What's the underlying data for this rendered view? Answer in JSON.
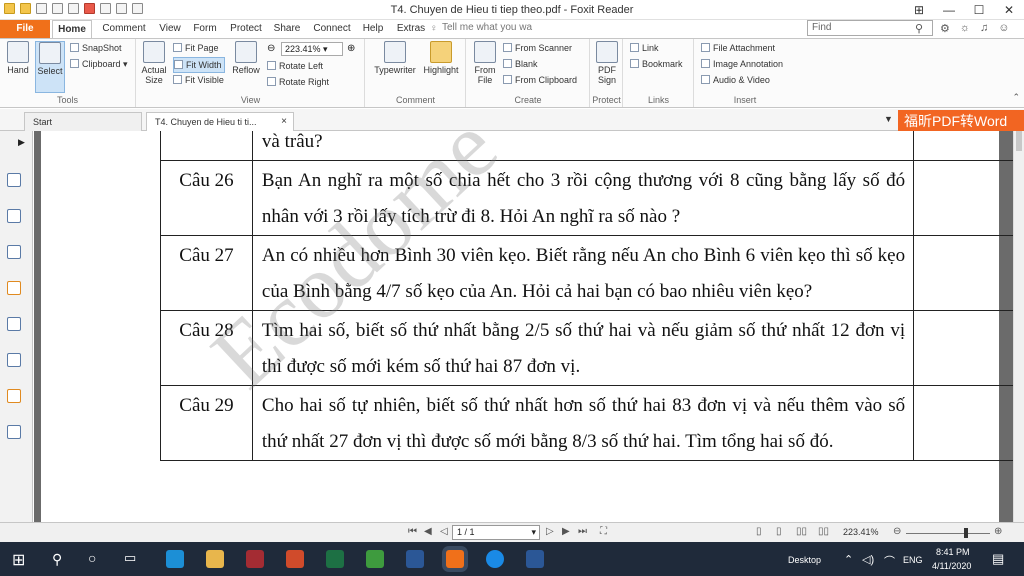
{
  "window": {
    "title": "T4. Chuyen de Hieu ti tiep theo.pdf - Foxit Reader"
  },
  "menu_tabs": [
    "File",
    "Home",
    "Comment",
    "View",
    "Form",
    "Protect",
    "Share",
    "Connect",
    "Help",
    "Extras"
  ],
  "tell_me": "Tell me what you wa",
  "find_placeholder": "Find",
  "ribbon": {
    "tools": {
      "hand": "Hand",
      "select": "Select",
      "snapshot": "SnapShot",
      "clipboard": "Clipboard",
      "label": "Tools"
    },
    "view": {
      "actual_size": "Actual Size",
      "fit_page": "Fit Page",
      "fit_width": "Fit Width",
      "fit_visible": "Fit Visible",
      "reflow": "Reflow",
      "zoom": "223.41%",
      "rotate_left": "Rotate Left",
      "rotate_right": "Rotate Right",
      "label": "View"
    },
    "comment": {
      "typewriter": "Typewriter",
      "highlight": "Highlight",
      "label": "Comment"
    },
    "create": {
      "from_file": "From File",
      "from_scanner": "From Scanner",
      "blank": "Blank",
      "from_clipboard": "From Clipboard",
      "label": "Create"
    },
    "protect": {
      "pdf_sign": "PDF Sign",
      "label": "Protect"
    },
    "links": {
      "link": "Link",
      "bookmark": "Bookmark",
      "label": "Links"
    },
    "insert": {
      "file_attachment": "File Attachment",
      "image_annotation": "Image Annotation",
      "audio_video": "Audio & Video",
      "label": "Insert"
    }
  },
  "doc_tabs": {
    "start": "Start",
    "current": "T4. Chuyen de Hieu ti ti...",
    "close": "×"
  },
  "promo": "福昕PDF转Word",
  "document": {
    "rows": [
      {
        "num": "",
        "text": "và trâu?"
      },
      {
        "num": "Câu 26",
        "text": "Bạn An nghĩ ra một số chia hết cho 3 rồi cộng thương với 8 cũng bằng lấy số đó nhân với 3 rồi lấy tích trừ đi 8. Hỏi An nghĩ ra số nào ?"
      },
      {
        "num": "Câu 27",
        "text": "An có nhiều hơn Bình 30 viên kẹo. Biết rằng nếu An cho Bình 6 viên kẹo thì số kẹo của Bình bằng 4/7 số kẹo của An. Hỏi cả hai bạn có bao nhiêu viên kẹo?"
      },
      {
        "num": "Câu 28",
        "text": "Tìm hai số, biết số thứ nhất bằng 2/5 số thứ hai và nếu giảm số thứ nhất 12 đơn vị thì được số mới kém số thứ hai 87 đơn vị."
      },
      {
        "num": "Câu 29",
        "text": "Cho hai số tự nhiên, biết số thứ nhất hơn số thứ hai 83 đơn vị và nếu thêm vào số thứ nhất 27 đơn vị thì được số mới bằng 8/3 số thứ hai. Tìm tổng hai số đó."
      }
    ],
    "watermark": "Ecodome"
  },
  "status": {
    "page": "1 / 1",
    "zoom": "223.41%"
  },
  "taskbar": {
    "desktop": "Desktop",
    "lang": "ENG",
    "time": "8:41 PM",
    "date": "4/11/2020"
  },
  "colors": {
    "accent": "#f0701a",
    "taskbar": "#1f2a3a"
  }
}
